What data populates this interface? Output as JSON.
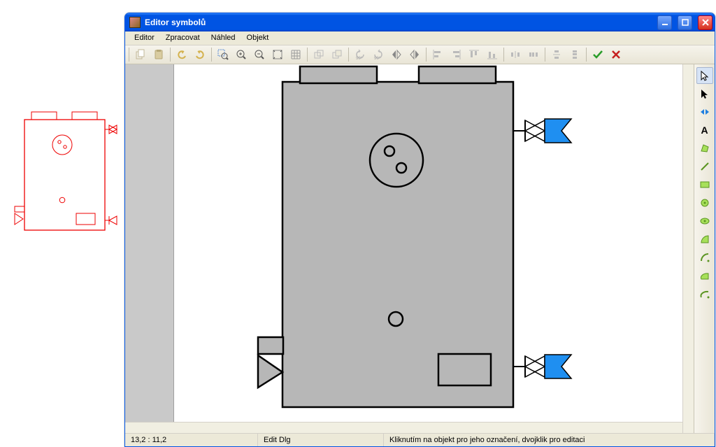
{
  "window": {
    "title": "Editor symbolů"
  },
  "menu": {
    "editor": "Editor",
    "zpracovat": "Zpracovat",
    "nahled": "Náhled",
    "objekt": "Objekt"
  },
  "status": {
    "coords": "13,2 :   11,2",
    "mode": "Edit Dlg",
    "hint": "Kliknutím na objekt pro jeho označení, dvojklik pro editaci"
  },
  "toolbar": {
    "copy": "copy",
    "paste": "paste",
    "undo": "undo",
    "redo": "redo",
    "zoom_area": "zoom-area",
    "zoom_in": "zoom-in",
    "zoom_out": "zoom-out",
    "fit": "fit",
    "grid": "grid",
    "dup": "dup",
    "group": "group",
    "rot_left": "90°",
    "rot_right": "90°",
    "flip_h": "flip-h",
    "flip_v": "flip-v",
    "align1": "align",
    "align2": "align",
    "align3": "align",
    "align4": "align",
    "dist1": "dist",
    "dist2": "dist",
    "dist3": "dist",
    "dist4": "dist",
    "ok": "ok",
    "cancel": "cancel"
  },
  "side": {
    "pointer": "pointer",
    "play": "cursor-solid",
    "reference": "reference",
    "text": "A",
    "polygon": "polygon",
    "line": "line",
    "rect": "rect",
    "circle": "circle",
    "ellipse": "ellipse",
    "arc1": "arc",
    "arc2": "arc",
    "arc3": "arc",
    "arc4": "arc"
  }
}
